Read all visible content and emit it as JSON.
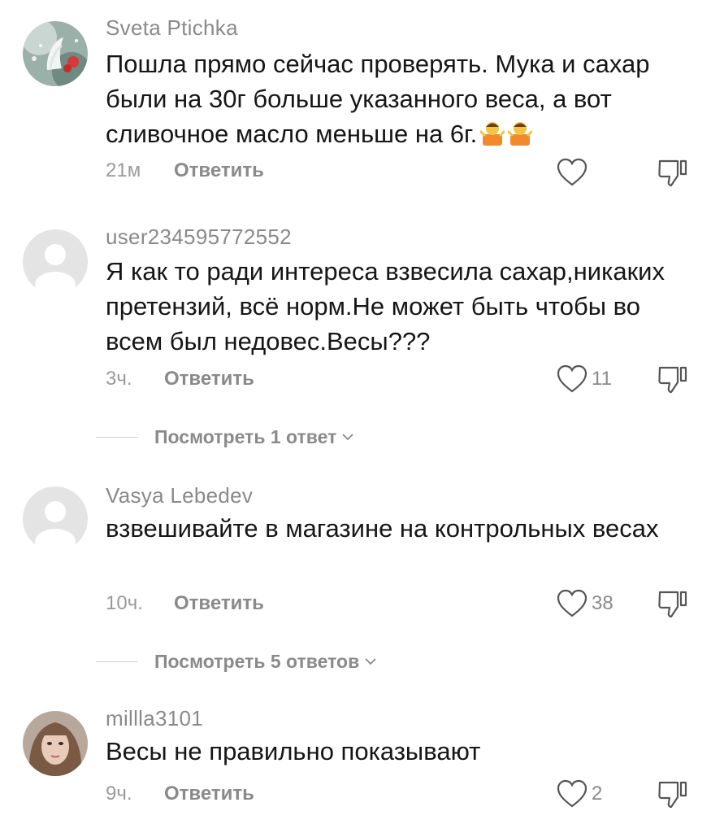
{
  "comments": [
    {
      "username": "Sveta Ptichka",
      "text": "Пошла прямо сейчас проверять. Мука и сахар были на 30г больше указанного веса, а вот сливочное масло меньше на 6г.",
      "time": "21м",
      "reply_label": "Ответить",
      "likes": "",
      "emoji": [
        "person-shrugging-emoji",
        "person-shrugging-emoji"
      ]
    },
    {
      "username": "user234595772552",
      "text": "Я как то ради интереса взвесила сахар,никаких претензий, всё норм.Не может быть чтобы во всем был недовес.Весы???",
      "time": "3ч.",
      "reply_label": "Ответить",
      "likes": "11",
      "view_replies": "Посмотреть 1 ответ"
    },
    {
      "username": "Vasya Lebedev",
      "text": "взвешивайте в магазине на контрольных весах",
      "time": "10ч.",
      "reply_label": "Ответить",
      "likes": "38",
      "view_replies": "Посмотреть 5 ответов"
    },
    {
      "username": "millla3101",
      "text": "Весы не правильно показывают",
      "time": "9ч.",
      "reply_label": "Ответить",
      "likes": "2"
    }
  ],
  "colors": {
    "text": "#161616",
    "secondary": "#8a8a8a",
    "divider": "#d0d0d0",
    "avatar_default": "#e4e4e4"
  }
}
